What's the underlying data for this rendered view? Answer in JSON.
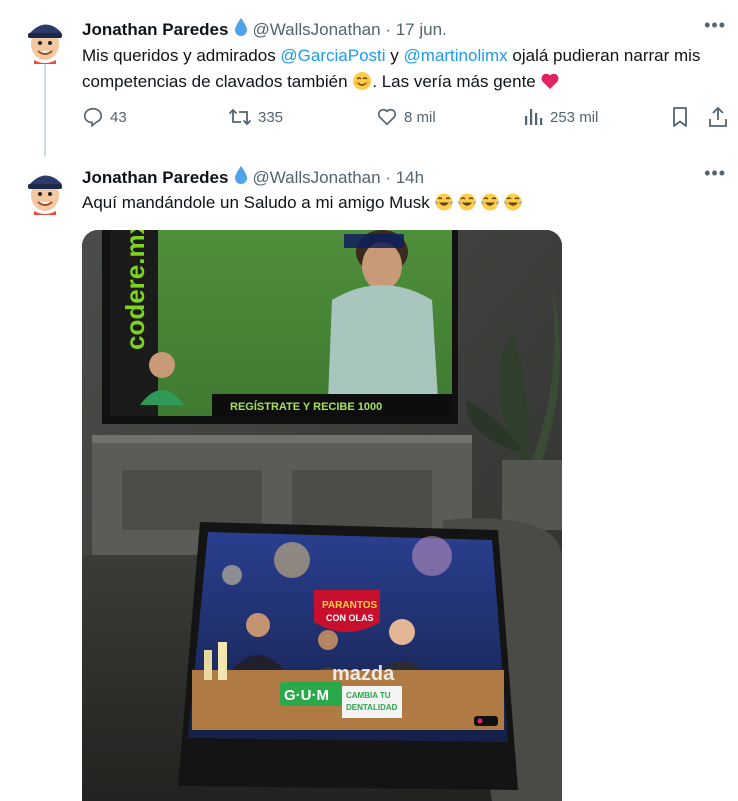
{
  "tweets": [
    {
      "author": "Jonathan Paredes",
      "handle": "@WallsJonathan",
      "time": "· 17 jun.",
      "text_parts": [
        "Mis queridos y admirados ",
        "@GarciaPosti",
        " y ",
        "@martinolimx",
        " ojalá pudieran narrar mis competencias de clavados también ",
        ". Las vería más gente "
      ],
      "reply_count": "43",
      "retweet_count": "335",
      "like_count": "8 mil",
      "view_count": "253 mil"
    },
    {
      "author": "Jonathan Paredes",
      "handle": "@WallsJonathan",
      "time": "· 14h",
      "text": "Aquí mandándole un Saludo a mi amigo Musk "
    }
  ],
  "media": {
    "tv_banner_brand": "codere.mx",
    "tv_bottom_banner": "REGÍSTRATE Y RECIBE 1000",
    "tablet_show_logo_line1": "PARANTOS",
    "tablet_show_logo_line2": "CON OLAS",
    "tablet_ad_brand": "G·U·M",
    "tablet_ad_line1": "CAMBIA TU",
    "tablet_ad_line2": "DENTALIDAD",
    "tablet_sponsor": "mazda"
  },
  "colors": {
    "text": "#0f1419",
    "muted": "#536471",
    "link": "#1d9bf0",
    "verified": "#4fa3e8",
    "heart": "#e0245e"
  },
  "icons": [
    "verified-drop-icon",
    "more-icon",
    "reply-icon",
    "retweet-icon",
    "like-icon",
    "views-icon",
    "bookmark-icon",
    "share-icon",
    "smiling-face-icon",
    "red-heart-icon",
    "tears-of-joy-icon"
  ]
}
